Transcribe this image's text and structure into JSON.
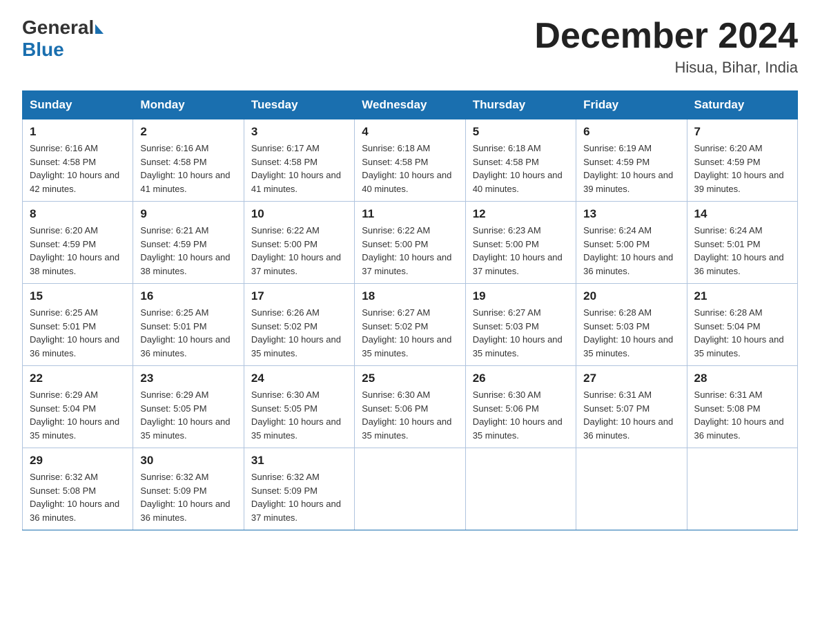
{
  "logo": {
    "word1": "General",
    "arrow": true,
    "word2": "Blue"
  },
  "title": {
    "month_year": "December 2024",
    "location": "Hisua, Bihar, India"
  },
  "weekdays": [
    "Sunday",
    "Monday",
    "Tuesday",
    "Wednesday",
    "Thursday",
    "Friday",
    "Saturday"
  ],
  "weeks": [
    [
      {
        "day": "1",
        "sunrise": "6:16 AM",
        "sunset": "4:58 PM",
        "daylight": "10 hours and 42 minutes."
      },
      {
        "day": "2",
        "sunrise": "6:16 AM",
        "sunset": "4:58 PM",
        "daylight": "10 hours and 41 minutes."
      },
      {
        "day": "3",
        "sunrise": "6:17 AM",
        "sunset": "4:58 PM",
        "daylight": "10 hours and 41 minutes."
      },
      {
        "day": "4",
        "sunrise": "6:18 AM",
        "sunset": "4:58 PM",
        "daylight": "10 hours and 40 minutes."
      },
      {
        "day": "5",
        "sunrise": "6:18 AM",
        "sunset": "4:58 PM",
        "daylight": "10 hours and 40 minutes."
      },
      {
        "day": "6",
        "sunrise": "6:19 AM",
        "sunset": "4:59 PM",
        "daylight": "10 hours and 39 minutes."
      },
      {
        "day": "7",
        "sunrise": "6:20 AM",
        "sunset": "4:59 PM",
        "daylight": "10 hours and 39 minutes."
      }
    ],
    [
      {
        "day": "8",
        "sunrise": "6:20 AM",
        "sunset": "4:59 PM",
        "daylight": "10 hours and 38 minutes."
      },
      {
        "day": "9",
        "sunrise": "6:21 AM",
        "sunset": "4:59 PM",
        "daylight": "10 hours and 38 minutes."
      },
      {
        "day": "10",
        "sunrise": "6:22 AM",
        "sunset": "5:00 PM",
        "daylight": "10 hours and 37 minutes."
      },
      {
        "day": "11",
        "sunrise": "6:22 AM",
        "sunset": "5:00 PM",
        "daylight": "10 hours and 37 minutes."
      },
      {
        "day": "12",
        "sunrise": "6:23 AM",
        "sunset": "5:00 PM",
        "daylight": "10 hours and 37 minutes."
      },
      {
        "day": "13",
        "sunrise": "6:24 AM",
        "sunset": "5:00 PM",
        "daylight": "10 hours and 36 minutes."
      },
      {
        "day": "14",
        "sunrise": "6:24 AM",
        "sunset": "5:01 PM",
        "daylight": "10 hours and 36 minutes."
      }
    ],
    [
      {
        "day": "15",
        "sunrise": "6:25 AM",
        "sunset": "5:01 PM",
        "daylight": "10 hours and 36 minutes."
      },
      {
        "day": "16",
        "sunrise": "6:25 AM",
        "sunset": "5:01 PM",
        "daylight": "10 hours and 36 minutes."
      },
      {
        "day": "17",
        "sunrise": "6:26 AM",
        "sunset": "5:02 PM",
        "daylight": "10 hours and 35 minutes."
      },
      {
        "day": "18",
        "sunrise": "6:27 AM",
        "sunset": "5:02 PM",
        "daylight": "10 hours and 35 minutes."
      },
      {
        "day": "19",
        "sunrise": "6:27 AM",
        "sunset": "5:03 PM",
        "daylight": "10 hours and 35 minutes."
      },
      {
        "day": "20",
        "sunrise": "6:28 AM",
        "sunset": "5:03 PM",
        "daylight": "10 hours and 35 minutes."
      },
      {
        "day": "21",
        "sunrise": "6:28 AM",
        "sunset": "5:04 PM",
        "daylight": "10 hours and 35 minutes."
      }
    ],
    [
      {
        "day": "22",
        "sunrise": "6:29 AM",
        "sunset": "5:04 PM",
        "daylight": "10 hours and 35 minutes."
      },
      {
        "day": "23",
        "sunrise": "6:29 AM",
        "sunset": "5:05 PM",
        "daylight": "10 hours and 35 minutes."
      },
      {
        "day": "24",
        "sunrise": "6:30 AM",
        "sunset": "5:05 PM",
        "daylight": "10 hours and 35 minutes."
      },
      {
        "day": "25",
        "sunrise": "6:30 AM",
        "sunset": "5:06 PM",
        "daylight": "10 hours and 35 minutes."
      },
      {
        "day": "26",
        "sunrise": "6:30 AM",
        "sunset": "5:06 PM",
        "daylight": "10 hours and 35 minutes."
      },
      {
        "day": "27",
        "sunrise": "6:31 AM",
        "sunset": "5:07 PM",
        "daylight": "10 hours and 36 minutes."
      },
      {
        "day": "28",
        "sunrise": "6:31 AM",
        "sunset": "5:08 PM",
        "daylight": "10 hours and 36 minutes."
      }
    ],
    [
      {
        "day": "29",
        "sunrise": "6:32 AM",
        "sunset": "5:08 PM",
        "daylight": "10 hours and 36 minutes."
      },
      {
        "day": "30",
        "sunrise": "6:32 AM",
        "sunset": "5:09 PM",
        "daylight": "10 hours and 36 minutes."
      },
      {
        "day": "31",
        "sunrise": "6:32 AM",
        "sunset": "5:09 PM",
        "daylight": "10 hours and 37 minutes."
      },
      null,
      null,
      null,
      null
    ]
  ],
  "labels": {
    "sunrise": "Sunrise:",
    "sunset": "Sunset:",
    "daylight": "Daylight:"
  }
}
